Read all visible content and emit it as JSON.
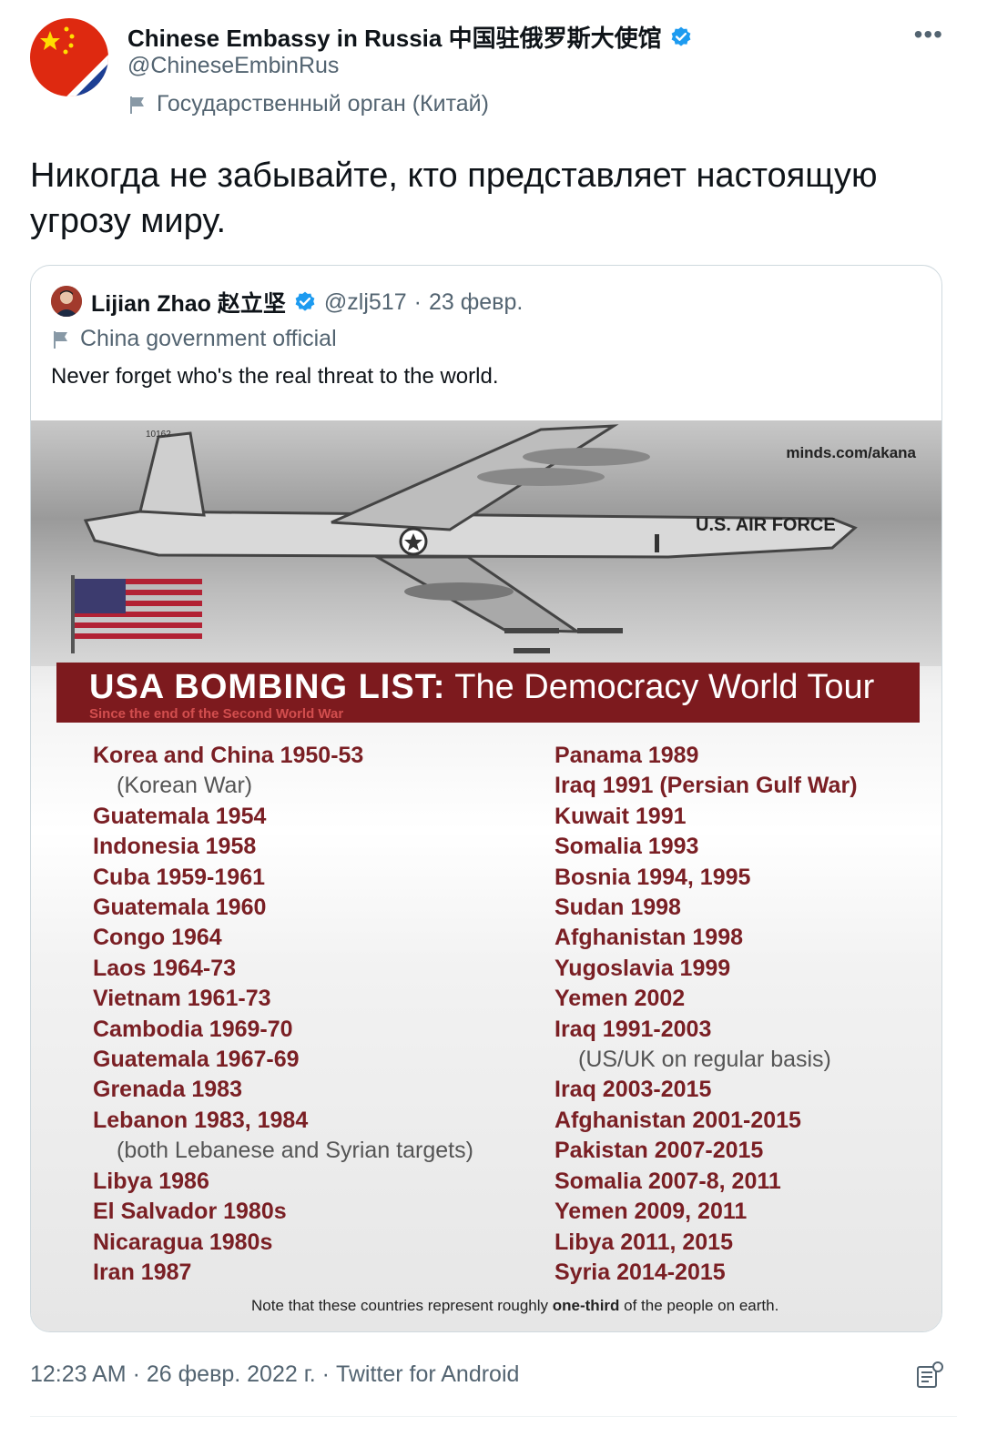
{
  "tweet": {
    "author_name": "Chinese Embassy in Russia 中国驻俄罗斯大使馆",
    "handle": "@ChineseEmbinRus",
    "gov_label": "Государственный орган (Китай)",
    "more_icon": "more-icon",
    "text": "Никогда не забывайте, кто представляет настоящую угрозу миру.",
    "footer": "12:23 AM · 26 февр. 2022 г. · Twitter for Android"
  },
  "quote": {
    "author_name": "Lijian Zhao 赵立坚",
    "handle": "@zlj517",
    "separator": "·",
    "date": "23 февр.",
    "gov_label": "China government official",
    "text": "Never forget who's the real threat to the world."
  },
  "image": {
    "watermark": "minds.com/akana",
    "plane_text": "U.S. AIR FORCE",
    "plane_tail": "10162",
    "banner_title_bold": "USA BOMBING LIST:",
    "banner_title_rest": "The Democracy World Tour",
    "banner_subtitle": "Since the end of the Second World War",
    "left_list": [
      {
        "text": "Korea and China 1950-53",
        "sub": false
      },
      {
        "text": "(Korean War)",
        "sub": true
      },
      {
        "text": "Guatemala 1954",
        "sub": false
      },
      {
        "text": "Indonesia 1958",
        "sub": false
      },
      {
        "text": "Cuba 1959-1961",
        "sub": false
      },
      {
        "text": "Guatemala 1960",
        "sub": false
      },
      {
        "text": "Congo 1964",
        "sub": false
      },
      {
        "text": "Laos 1964-73",
        "sub": false
      },
      {
        "text": "Vietnam 1961-73",
        "sub": false
      },
      {
        "text": "Cambodia 1969-70",
        "sub": false
      },
      {
        "text": "Guatemala 1967-69",
        "sub": false
      },
      {
        "text": "Grenada 1983",
        "sub": false
      },
      {
        "text": "Lebanon 1983, 1984",
        "sub": false
      },
      {
        "text": "(both Lebanese and Syrian targets)",
        "sub": true
      },
      {
        "text": "Libya 1986",
        "sub": false
      },
      {
        "text": "El Salvador 1980s",
        "sub": false
      },
      {
        "text": "Nicaragua 1980s",
        "sub": false
      },
      {
        "text": "Iran 1987",
        "sub": false
      }
    ],
    "right_list": [
      {
        "text": "Panama 1989",
        "sub": false
      },
      {
        "text": "Iraq 1991 (Persian Gulf War)",
        "sub": false
      },
      {
        "text": "Kuwait 1991",
        "sub": false
      },
      {
        "text": "Somalia 1993",
        "sub": false
      },
      {
        "text": "Bosnia 1994, 1995",
        "sub": false
      },
      {
        "text": "Sudan 1998",
        "sub": false
      },
      {
        "text": "Afghanistan 1998",
        "sub": false
      },
      {
        "text": "Yugoslavia 1999",
        "sub": false
      },
      {
        "text": "Yemen 2002",
        "sub": false
      },
      {
        "text": "Iraq 1991-2003",
        "sub": false
      },
      {
        "text": "(US/UK on regular basis)",
        "sub": true
      },
      {
        "text": "Iraq 2003-2015",
        "sub": false
      },
      {
        "text": "Afghanistan 2001-2015",
        "sub": false
      },
      {
        "text": "Pakistan 2007-2015",
        "sub": false
      },
      {
        "text": "Somalia 2007-8, 2011",
        "sub": false
      },
      {
        "text": "Yemen 2009, 2011",
        "sub": false
      },
      {
        "text": "Libya 2011, 2015",
        "sub": false
      },
      {
        "text": "Syria 2014-2015",
        "sub": false
      }
    ],
    "note_before": "Note that these countries represent roughly",
    "note_bold": "one-third",
    "note_after": "of the people on earth."
  },
  "colors": {
    "verified": "#1d9bf0",
    "secondary_text": "#536471",
    "banner": "#7d1a1e",
    "list_text": "#7a1f24"
  }
}
